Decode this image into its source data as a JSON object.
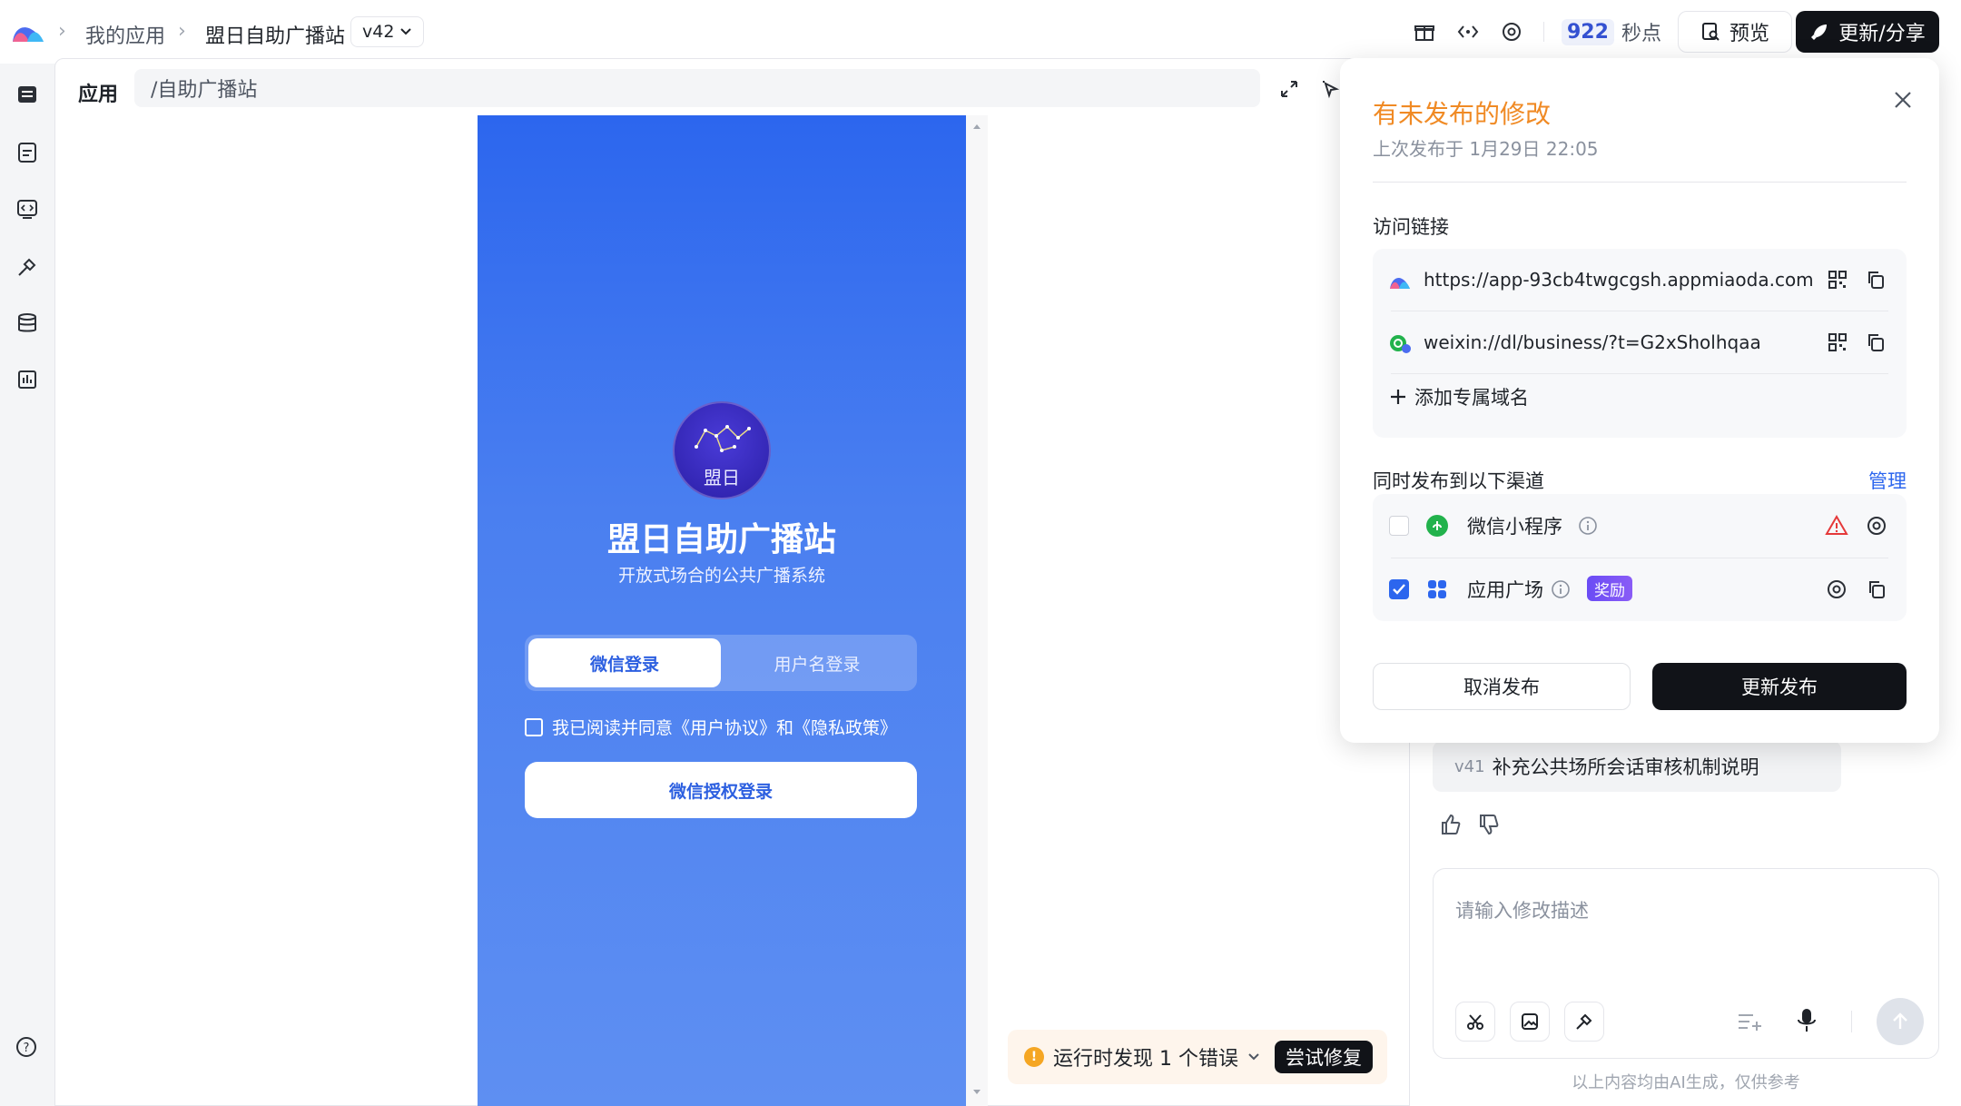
{
  "topbar": {
    "crumbs": [
      "我的应用",
      "盟日自助广播站"
    ],
    "version": "v42",
    "points_value": "922",
    "points_unit": "秒点",
    "preview_label": "预览",
    "share_label": "更新/分享"
  },
  "workspace": {
    "app_tab": "应用",
    "url": "/自助广播站"
  },
  "phone": {
    "avatar_text": "盟日",
    "app_title": "盟日自助广播站",
    "app_subtitle": "开放式场合的公共广播系统",
    "tabs": [
      "微信登录",
      "用户名登录"
    ],
    "agreement": "我已阅读并同意《用户协议》和《隐私政策》",
    "wx_button": "微信授权登录"
  },
  "error_bar": {
    "text": "运行时发现 1 个错误",
    "fix_label": "尝试修复"
  },
  "publish_popup": {
    "title": "有未发布的修改",
    "subtitle": "上次发布于 1月29日 22:05",
    "access_label": "访问链接",
    "links": [
      "https://app-93cb4twgcgsh.appmiaoda.com",
      "weixin://dl/business/?t=G2xSholhqaa"
    ],
    "add_domain": "添加专属域名",
    "channels_label": "同时发布到以下渠道",
    "manage_label": "管理",
    "channels": [
      {
        "name": "微信小程序",
        "checked": false
      },
      {
        "name": "应用广场",
        "checked": true,
        "badge": "奖励"
      }
    ],
    "cancel_label": "取消发布",
    "update_label": "更新发布"
  },
  "chat": {
    "version_tag": "v41",
    "version_msg": "补充公共场所会话审核机制说明",
    "input_placeholder": "请输入修改描述",
    "disclaimer": "以上内容均由AI生成，仅供参考"
  },
  "colors": {
    "accent": "#2c66ee",
    "warning_title": "#f08a24",
    "dark_button": "#111318"
  }
}
